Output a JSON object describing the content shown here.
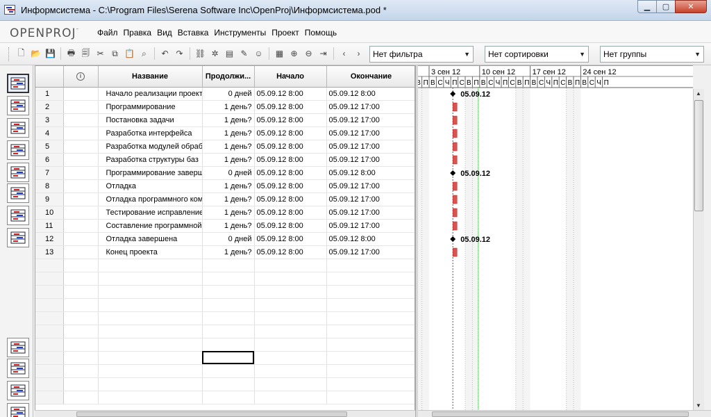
{
  "window": {
    "title": "Информсистема - C:\\Program Files\\Serena Software Inc\\OpenProj\\Информсистема.pod *",
    "minimize": "▁",
    "maximize": "▢",
    "close": "✕"
  },
  "logo": {
    "text_a": "OPEN",
    "text_b": "PROJ",
    "mark": "˜"
  },
  "menu": [
    "Файл",
    "Правка",
    "Вид",
    "Вставка",
    "Инструменты",
    "Проект",
    "Помощь"
  ],
  "toolbar": {
    "filter": "Нет фильтра",
    "sort": "Нет сортировки",
    "group": "Нет группы",
    "icons": [
      "new-icon",
      "open-icon",
      "save-icon",
      "print-icon",
      "print-preview-icon",
      "cut-icon",
      "copy-icon",
      "paste-icon",
      "find-icon",
      "undo-icon",
      "redo-icon",
      "link-icon",
      "unlink-icon",
      "task-info-icon",
      "notes-icon",
      "assign-resources-icon",
      "calendar-icon",
      "zoom-in-icon",
      "zoom-out-icon",
      "scroll-to-task-icon",
      "prev-icon",
      "next-icon"
    ]
  },
  "table": {
    "columns": [
      "",
      "ⓘ",
      "Название",
      "Продолжи...",
      "Начало",
      "Окончание"
    ],
    "rows": [
      {
        "id": "1",
        "name": "Начало реализации проекта",
        "duration": "0 дней",
        "start": "05.09.12 8:00",
        "finish": "05.09.12 8:00"
      },
      {
        "id": "2",
        "name": "Программирование",
        "duration": "1 день?",
        "start": "05.09.12 8:00",
        "finish": "05.09.12 17:00"
      },
      {
        "id": "3",
        "name": "Постановка задачи",
        "duration": "1 день?",
        "start": "05.09.12 8:00",
        "finish": "05.09.12 17:00"
      },
      {
        "id": "4",
        "name": "Разработка интерфейса",
        "duration": "1 день?",
        "start": "05.09.12 8:00",
        "finish": "05.09.12 17:00"
      },
      {
        "id": "5",
        "name": "Разработка модулей обраб",
        "duration": "1 день?",
        "start": "05.09.12 8:00",
        "finish": "05.09.12 17:00"
      },
      {
        "id": "6",
        "name": "Разработка структуры  баз",
        "duration": "1 день?",
        "start": "05.09.12 8:00",
        "finish": "05.09.12 17:00"
      },
      {
        "id": "7",
        "name": "Программирование заверш",
        "duration": "0 дней",
        "start": "05.09.12 8:00",
        "finish": "05.09.12 8:00"
      },
      {
        "id": "8",
        "name": "Отладка",
        "duration": "1 день?",
        "start": "05.09.12 8:00",
        "finish": "05.09.12 17:00"
      },
      {
        "id": "9",
        "name": "Отладка программного ком",
        "duration": "1 день?",
        "start": "05.09.12 8:00",
        "finish": "05.09.12 17:00"
      },
      {
        "id": "10",
        "name": "Тестирование исправление",
        "duration": "1 день?",
        "start": "05.09.12 8:00",
        "finish": "05.09.12 17:00"
      },
      {
        "id": "11",
        "name": "Составление программной",
        "duration": "1 день?",
        "start": "05.09.12 8:00",
        "finish": "05.09.12 17:00"
      },
      {
        "id": "12",
        "name": "Отладка завершена",
        "duration": "0 дней",
        "start": "05.09.12 8:00",
        "finish": "05.09.12 8:00"
      },
      {
        "id": "13",
        "name": "Конец проекта",
        "duration": "1 день?",
        "start": "05.09.12 8:00",
        "finish": "05.09.12 17:00"
      }
    ],
    "empty_rows": 11
  },
  "gantt": {
    "weeks": [
      "3 сен 12",
      "10 сен 12",
      "17 сен 12",
      "24 сен 12"
    ],
    "day_letters": [
      "В",
      "П",
      "В",
      "С",
      "Ч",
      "П",
      "С",
      "В",
      "П",
      "В",
      "С",
      "Ч",
      "П",
      "С",
      "В",
      "П",
      "В",
      "С",
      "Ч",
      "П",
      "С",
      "В",
      "П",
      "В",
      "С",
      "Ч",
      "П"
    ],
    "milestone_label": "05.09.12",
    "bars": [
      {
        "row": 1,
        "type": "milestone"
      },
      {
        "row": 2,
        "type": "task"
      },
      {
        "row": 3,
        "type": "task"
      },
      {
        "row": 4,
        "type": "task"
      },
      {
        "row": 5,
        "type": "task"
      },
      {
        "row": 6,
        "type": "task"
      },
      {
        "row": 7,
        "type": "milestone"
      },
      {
        "row": 8,
        "type": "task"
      },
      {
        "row": 9,
        "type": "task"
      },
      {
        "row": 10,
        "type": "task"
      },
      {
        "row": 11,
        "type": "task"
      },
      {
        "row": 12,
        "type": "milestone"
      },
      {
        "row": 13,
        "type": "task"
      }
    ],
    "bar_color": "#d9534f",
    "today_line_color": "#2ca02c"
  },
  "views": [
    "gantt-view-icon",
    "network-view-icon",
    "resources-view-icon",
    "wbs-view-icon",
    "rbs-view-icon",
    "reports-view-icon",
    "task-usage-view-icon",
    "resource-usage-view-icon",
    "histogram-view-icon",
    "charts-view-icon",
    "task-usage-lower-icon",
    "resource-usage-lower-icon"
  ]
}
